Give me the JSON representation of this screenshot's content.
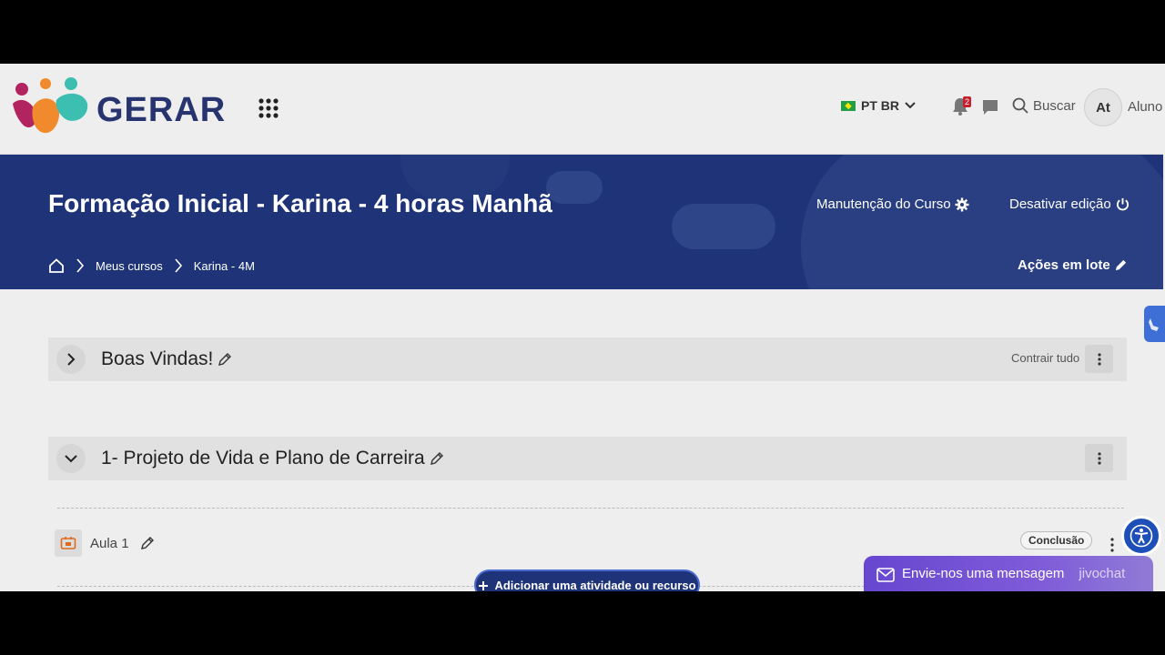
{
  "brand": {
    "name": "GERAR"
  },
  "navbar": {
    "language": "PT BR",
    "notification_count": "2",
    "search_label": "Buscar",
    "user_initials": "At",
    "user_name": "Aluno"
  },
  "header": {
    "course_title": "Formação Inicial - Karina - 4 horas Manhã",
    "maintenance_label": "Manutenção do Curso",
    "disable_edit_label": "Desativar edição",
    "bulk_actions_label": "Ações em lote",
    "breadcrumb": [
      "Meus cursos",
      "Karina - 4M"
    ]
  },
  "sections": [
    {
      "title": "Boas Vindas!",
      "collapse_all_label": "Contrair tudo"
    },
    {
      "title": "1- Projeto de Vida e Plano de Carreira"
    }
  ],
  "activity": {
    "name": "Aula 1",
    "completion_label": "Conclusão"
  },
  "add_activity_label": "Adicionar uma atividade ou recurso",
  "chat": {
    "message": "Envie-nos uma mensagem",
    "brand": "jivochat"
  },
  "colors": {
    "banner": "#1f3478",
    "brand_text": "#27346f",
    "chat": "#6747d0"
  }
}
